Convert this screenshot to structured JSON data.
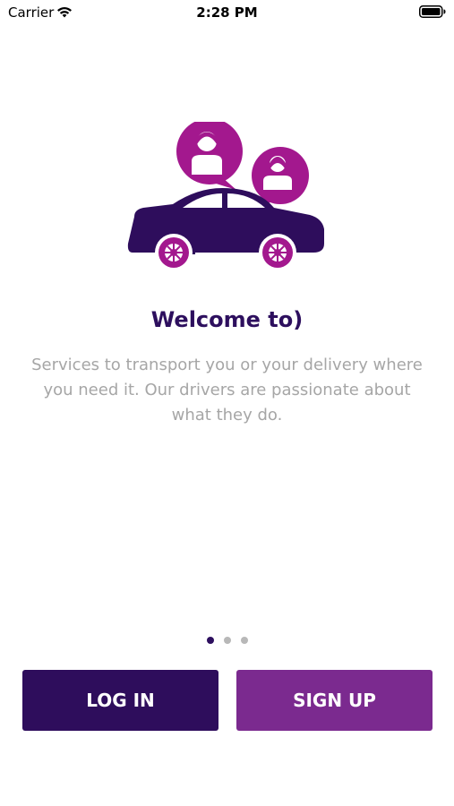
{
  "status_bar": {
    "carrier": "Carrier",
    "time": "2:28 PM",
    "wifi_icon": "wifi-icon",
    "battery_icon": "battery-icon"
  },
  "onboarding": {
    "illustration_icon": "car-with-driver-and-passenger-chat-bubbles-icon",
    "title": "Welcome to)",
    "description": "Services to transport you or your delivery where you need it. Our drivers are passionate about what they do.",
    "page_indicator": {
      "pages": 3,
      "current": 1
    }
  },
  "actions": {
    "login_label": "LOG IN",
    "signup_label": "SIGN UP"
  },
  "colors": {
    "primary": "#2e0d5c",
    "accent": "#7b2a8f",
    "bubble": "#a3188e",
    "text_muted": "#a6a6a6"
  }
}
